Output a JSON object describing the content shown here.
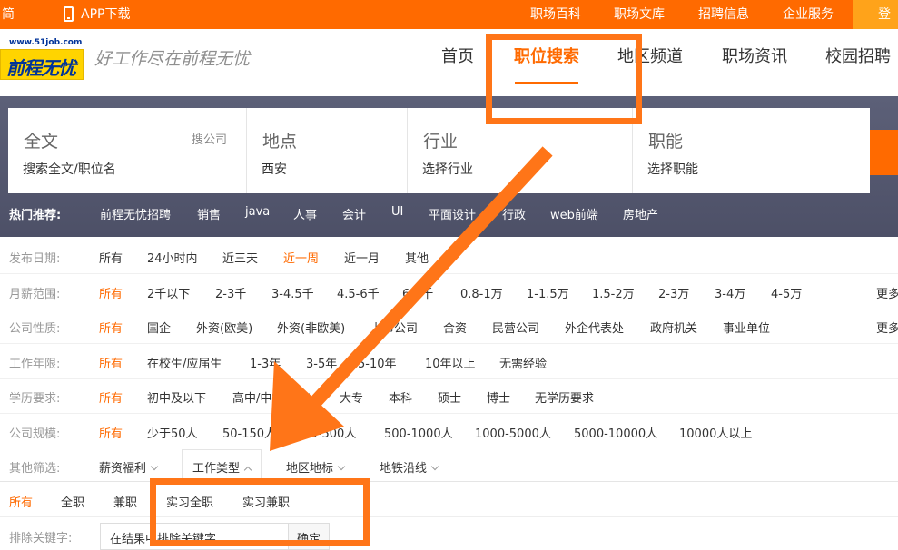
{
  "topbar": {
    "simplified": "简",
    "app_download": "APP下载",
    "links": [
      "职场百科",
      "职场文库",
      "招聘信息",
      "企业服务"
    ],
    "login_partial": "登",
    "bg_color": "#ff6a00"
  },
  "header": {
    "logo_url_text": "www.51job.com",
    "logo_text": "前程无忧",
    "slogan": "好工作尽在前程无忧",
    "nav": [
      "首页",
      "职位搜索",
      "地区频道",
      "职场资讯",
      "校园招聘"
    ],
    "active_nav": "职位搜索"
  },
  "search": {
    "fulltext_title": "全文",
    "search_company": "搜公司",
    "fulltext_placeholder": "搜索全文/职位名",
    "location_title": "地点",
    "location_value": "西安",
    "industry_title": "行业",
    "industry_placeholder": "选择行业",
    "function_title": "职能",
    "function_placeholder": "选择职能"
  },
  "hot": {
    "label": "热门推荐:",
    "items": [
      "前程无忧招聘",
      "销售",
      "java",
      "人事",
      "会计",
      "UI",
      "平面设计",
      "行政",
      "web前端",
      "房地产"
    ]
  },
  "filters": {
    "date": {
      "label": "发布日期:",
      "options": [
        "所有",
        "24小时内",
        "近三天",
        "近一周",
        "近一月",
        "其他"
      ],
      "selected": "近一周"
    },
    "salary": {
      "label": "月薪范围:",
      "options": [
        "所有",
        "2千以下",
        "2-3千",
        "3-4.5千",
        "4.5-6千",
        "6-8千",
        "0.8-1万",
        "1-1.5万",
        "1.5-2万",
        "2-3万",
        "3-4万",
        "4-5万"
      ],
      "more": "更多",
      "selected": "所有"
    },
    "company_type": {
      "label": "公司性质:",
      "options": [
        "所有",
        "国企",
        "外资(欧美)",
        "外资(非欧美)",
        "上市公司",
        "合资",
        "民营公司",
        "外企代表处",
        "政府机关",
        "事业单位"
      ],
      "more": "更多",
      "selected": "所有"
    },
    "experience": {
      "label": "工作年限:",
      "options": [
        "所有",
        "在校生/应届生",
        "1-3年",
        "3-5年",
        "5-10年",
        "10年以上",
        "无需经验"
      ],
      "selected": "所有"
    },
    "education": {
      "label": "学历要求:",
      "options": [
        "所有",
        "初中及以下",
        "高中/中技/中专",
        "大专",
        "本科",
        "硕士",
        "博士",
        "无学历要求"
      ],
      "selected": "所有"
    },
    "company_size": {
      "label": "公司规模:",
      "options": [
        "所有",
        "少于50人",
        "50-150人",
        "150-500人",
        "500-1000人",
        "1000-5000人",
        "5000-10000人",
        "10000人以上"
      ],
      "selected": "所有"
    },
    "other": {
      "label": "其他筛选:",
      "tabs": [
        "薪资福利",
        "工作类型",
        "地区地标",
        "地铁沿线"
      ],
      "active_tab": "工作类型"
    },
    "job_type": {
      "options": [
        "所有",
        "全职",
        "兼职",
        "实习全职",
        "实习兼职"
      ],
      "selected": "所有"
    },
    "exclude": {
      "label": "排除关键字:",
      "placeholder": "在结果中排除关键字",
      "confirm": "确定"
    }
  },
  "annotation": {
    "color": "#ff7518"
  }
}
